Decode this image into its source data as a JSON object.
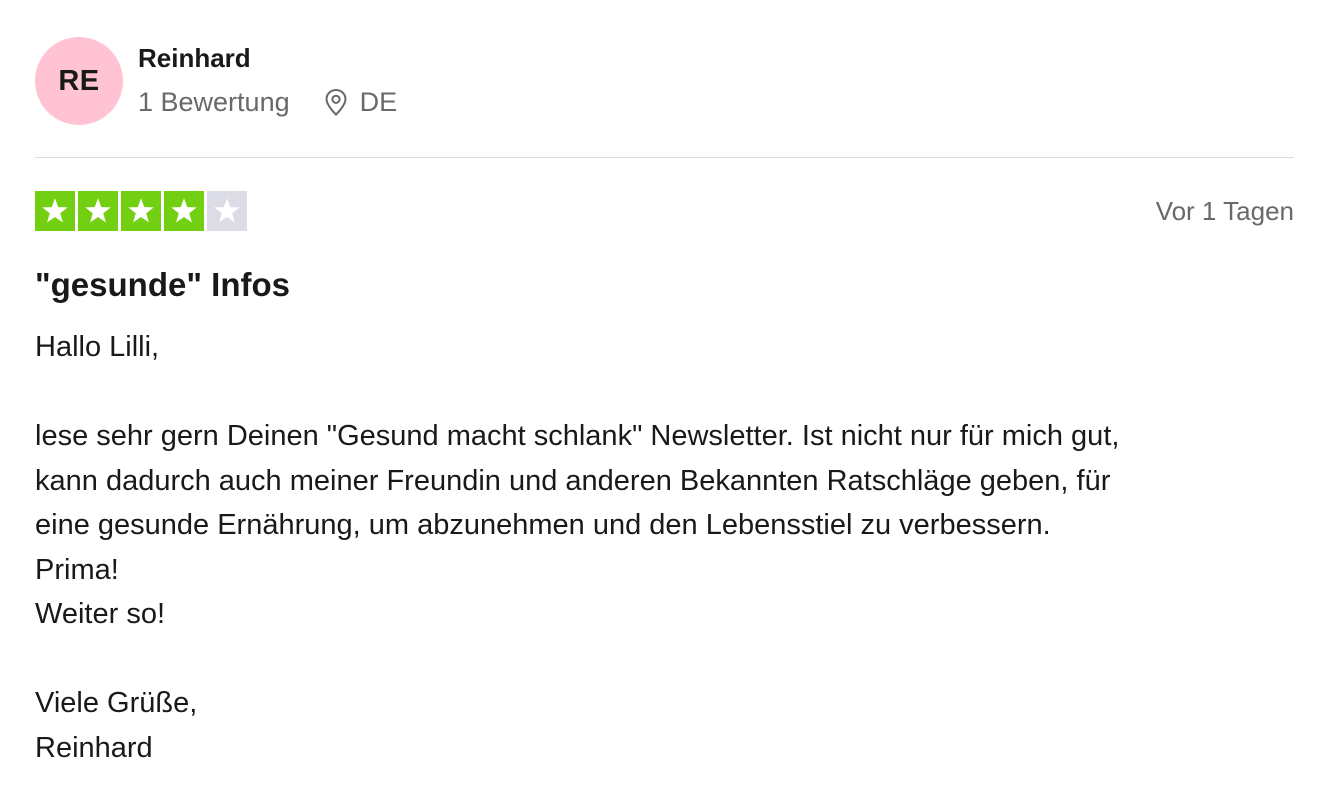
{
  "review": {
    "consumer": {
      "initials": "RE",
      "name": "Reinhard",
      "review_count": "1 Bewertung",
      "country": "DE",
      "avatar_color": "#ffc3d4"
    },
    "rating": {
      "value": 4,
      "max": 5,
      "filled_color": "#73cf11",
      "empty_color": "#dcdce6"
    },
    "date": "Vor 1 Tagen",
    "title": "\"gesunde\" Infos",
    "paragraphs": [
      "Hallo Lilli,",
      "lese sehr gern Deinen \"Gesund macht schlank\" Newsletter. Ist nicht nur für mich gut,\nkann dadurch auch meiner Freundin und anderen Bekannten Ratschläge geben, für\neine gesunde Ernährung, um abzunehmen und den Lebensstiel zu verbessern.\nPrima!\nWeiter so!",
      "Viele Grüße,\nReinhard"
    ],
    "icons": {
      "location": "location-pin-icon",
      "star": "star-icon"
    }
  }
}
